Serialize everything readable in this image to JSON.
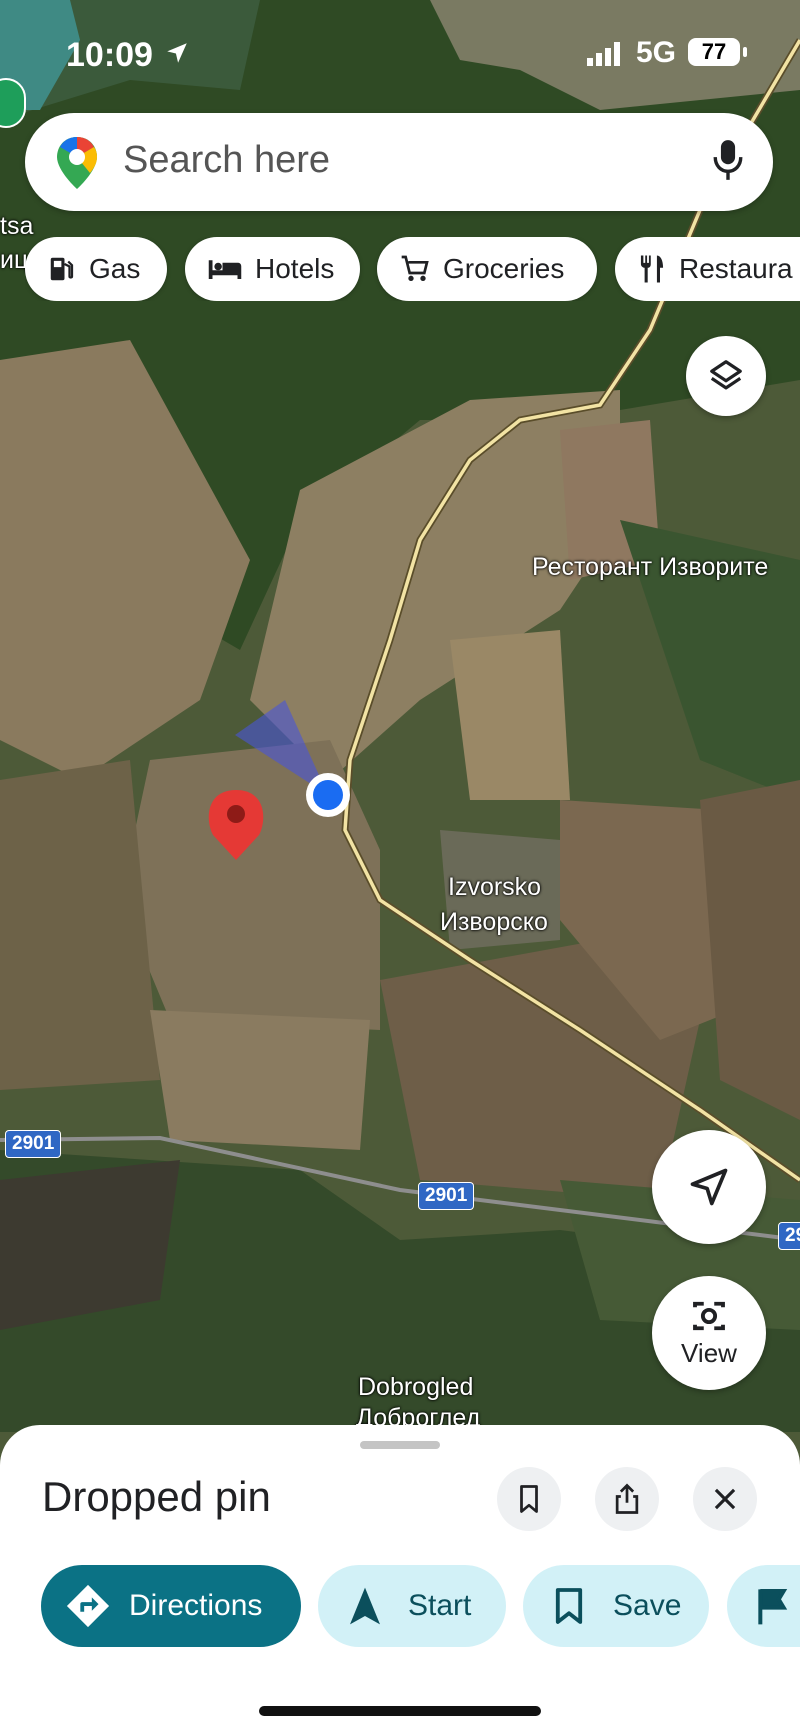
{
  "status_bar": {
    "time": "10:09",
    "network": "5G",
    "battery": "77"
  },
  "search": {
    "placeholder": "Search here"
  },
  "chips": [
    {
      "label": "Gas",
      "icon": "gas-station-icon"
    },
    {
      "label": "Hotels",
      "icon": "bed-icon"
    },
    {
      "label": "Groceries",
      "icon": "cart-icon"
    },
    {
      "label": "Restaura",
      "icon": "fork-knife-icon"
    }
  ],
  "map": {
    "labels": {
      "restaurant": "Ресторант Изворите",
      "izvorsko_latin": "Izvorsko",
      "izvorsko_cyr": "Изворско",
      "dobrogled_latin": "Dobrogled",
      "dobrogled_cyr": "Доброглед",
      "left_cut_1": "tsa",
      "left_cut_2": "ицa"
    },
    "routes": {
      "r1": "2901",
      "r2": "2901",
      "r3": "29"
    }
  },
  "view_button": {
    "label": "View"
  },
  "sheet": {
    "title": "Dropped pin",
    "actions": [
      {
        "label": "Directions",
        "icon": "directions-icon"
      },
      {
        "label": "Start",
        "icon": "navigation-arrow-icon"
      },
      {
        "label": "Save",
        "icon": "bookmark-icon"
      },
      {
        "label": "",
        "icon": "flag-icon"
      }
    ]
  },
  "colors": {
    "teal": "#0b7285",
    "light_teal": "#d2f1f7",
    "map_bg": "#4a5a35"
  }
}
